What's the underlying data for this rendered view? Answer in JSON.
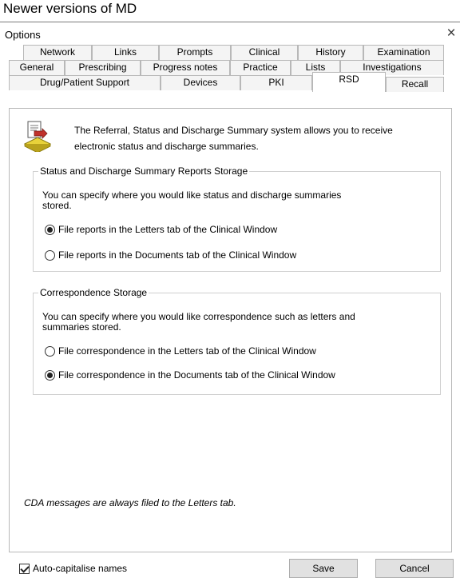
{
  "heading": "Newer versions of MD",
  "window": {
    "title": "Options",
    "close_glyph": "×"
  },
  "tabs": {
    "row1": [
      "Network",
      "Links",
      "Prompts",
      "Clinical",
      "History",
      "Examination"
    ],
    "row2": [
      "General",
      "Prescribing",
      "Progress notes",
      "Practice",
      "Lists",
      "Investigations"
    ],
    "row3": [
      "Drug/Patient Support",
      "Devices",
      "PKI",
      "RSD",
      "Recall"
    ],
    "active": "RSD"
  },
  "info": {
    "icon": "document-arrow-icon",
    "line1": "The Referral, Status and Discharge Summary system allows you to receive",
    "line2": "electronic status and discharge summaries."
  },
  "status_group": {
    "label": "Status and Discharge Summary Reports Storage",
    "desc_line1": "You can specify where you would like status and discharge summaries",
    "desc_line2": "stored.",
    "option_letters": "File reports in the Letters tab of the Clinical Window",
    "option_documents": "File reports in the Documents tab of the Clinical Window",
    "selected": "letters"
  },
  "correspondence_group": {
    "label": "Correspondence Storage",
    "desc_line1": "You can specify where you would like correspondence such as letters and",
    "desc_line2": "summaries stored.",
    "option_letters": "File correspondence in the Letters tab of the Clinical Window",
    "option_documents": "File correspondence in the Documents tab of the Clinical Window",
    "selected": "documents"
  },
  "note": "CDA messages are always filed to the Letters tab.",
  "footer": {
    "auto_capitalise_label": "Auto-capitalise names",
    "auto_capitalise_checked": true,
    "save_label": "Save",
    "cancel_label": "Cancel"
  },
  "colors": {
    "border": "#b8b8b8",
    "button_bg": "#e1e1e1",
    "icon_yellow": "#e8d23a",
    "icon_red": "#c0312b"
  }
}
